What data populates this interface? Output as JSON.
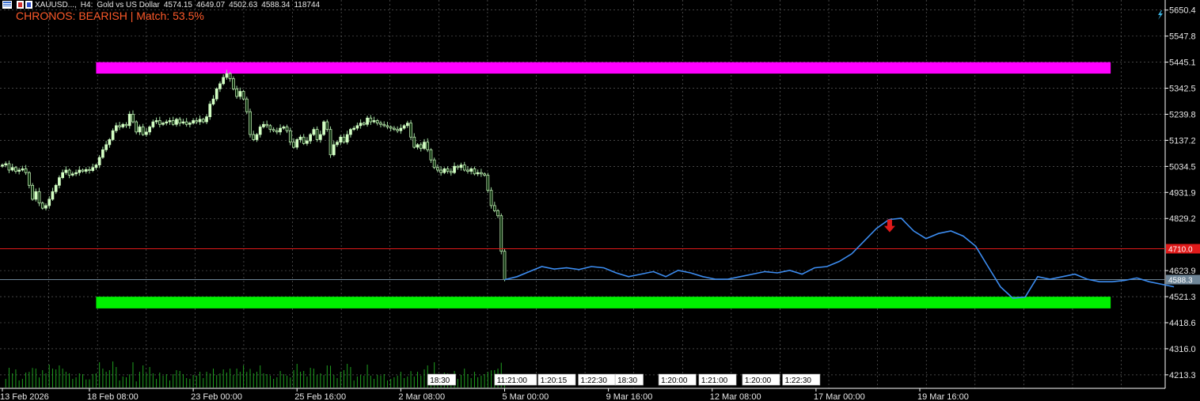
{
  "header": {
    "symbol": "XAUUSD...,",
    "timeframe": "H4:",
    "description": "Gold vs US Dollar",
    "open": "4574.15",
    "high": "4649.07",
    "low": "4502.63",
    "close": "4588.34",
    "volume": "118744"
  },
  "indicator": {
    "text": "CHRONOS: BEARISH | Match: 53.5%",
    "color": "#ff5a2a"
  },
  "colors": {
    "background": "#000000",
    "grid": "#c8c8c8",
    "bull_candle": "#d2ffc3",
    "bear_candle": "#c8ffd2",
    "wick": "#a0dca0",
    "volume": "#1f9f1f",
    "forecast": "#3c8cf0",
    "resistance_zone": "#ff00ff",
    "support_zone": "#00f000",
    "red_line": "#e01a1a",
    "signal_arrow": "#e01a1a",
    "bid_line": "#7a8fa0"
  },
  "chart_data": {
    "type": "candlestick",
    "y_axis_ticks": [
      "5650.4",
      "5547.8",
      "5445.1",
      "5342.5",
      "5239.8",
      "5137.2",
      "5034.5",
      "4931.9",
      "4829.2",
      "4623.9",
      "4521.3",
      "4418.6",
      "4316.0",
      "4213.3"
    ],
    "ylim": [
      4160,
      5690
    ],
    "x_axis_ticks": [
      "13 Feb 2026",
      "18 Feb 08:00",
      "23 Feb 00:00",
      "25 Feb 16:00",
      "2 Mar 08:00",
      "5 Mar 00:00",
      "9 Mar 16:00",
      "12 Mar 08:00",
      "17 Mar 00:00",
      "19 Mar 16:00"
    ],
    "x_axis_tick_bar_index": [
      0,
      26,
      57,
      88,
      119,
      150,
      181,
      212,
      243,
      274
    ],
    "price_tags": [
      {
        "label": "4710.0",
        "value": 4710.0,
        "bg": "#e01a1a",
        "fg": "#ffffff"
      },
      {
        "label": "4588.3",
        "value": 4588.3,
        "bg": "#6e8597",
        "fg": "#ffffff"
      }
    ],
    "zones": [
      {
        "name": "resistance",
        "from": 5400,
        "to": 5445,
        "start_bar": 28,
        "end_bar": 331
      },
      {
        "name": "support",
        "from": 4475,
        "to": 4521,
        "start_bar": 28,
        "end_bar": 331
      }
    ],
    "signal": {
      "type": "arrow-down",
      "bar": 265,
      "value": 4800
    },
    "time_tags": [
      "18:30",
      "11:21:00",
      "1:20:15",
      "1:22:30",
      "18:30",
      "1:20:00",
      "1:21:00",
      "1:20:00",
      "1:22:30"
    ],
    "time_tag_bar_index": [
      127,
      147,
      160,
      172,
      183,
      196,
      208,
      221,
      233
    ],
    "close_prices": [
      5040,
      5045,
      5020,
      5030,
      5015,
      5020,
      5025,
      5010,
      4960,
      4905,
      4935,
      4890,
      4870,
      4880,
      4905,
      4935,
      4960,
      4990,
      5010,
      5020,
      5000,
      5005,
      5010,
      5020,
      5015,
      5022,
      5018,
      5030,
      5040,
      5070,
      5100,
      5120,
      5140,
      5175,
      5195,
      5190,
      5200,
      5195,
      5240,
      5210,
      5170,
      5190,
      5160,
      5170,
      5190,
      5210,
      5215,
      5200,
      5205,
      5210,
      5215,
      5200,
      5220,
      5205,
      5210,
      5200,
      5205,
      5215,
      5210,
      5220,
      5210,
      5230,
      5280,
      5300,
      5340,
      5360,
      5385,
      5400,
      5380,
      5340,
      5310,
      5330,
      5300,
      5250,
      5160,
      5140,
      5160,
      5190,
      5200,
      5195,
      5180,
      5175,
      5170,
      5185,
      5190,
      5175,
      5130,
      5110,
      5140,
      5150,
      5125,
      5135,
      5160,
      5180,
      5140,
      5160,
      5210,
      5180,
      5080,
      5120,
      5130,
      5150,
      5130,
      5160,
      5180,
      5185,
      5195,
      5205,
      5200,
      5225,
      5210,
      5215,
      5205,
      5200,
      5195,
      5190,
      5185,
      5180,
      5175,
      5185,
      5195,
      5205,
      5150,
      5110,
      5120,
      5105,
      5130,
      5100,
      5060,
      5030,
      5020,
      5010,
      5025,
      5015,
      5010,
      5035,
      5030,
      5040,
      5020,
      5015,
      5025,
      5005,
      5010,
      5005,
      5000,
      4940,
      4880,
      4860,
      4840,
      4700,
      4588
    ],
    "forecast": [
      4588,
      4600,
      4620,
      4640,
      4630,
      4635,
      4628,
      4640,
      4635,
      4615,
      4600,
      4610,
      4620,
      4600,
      4625,
      4615,
      4600,
      4590,
      4590,
      4600,
      4610,
      4620,
      4615,
      4625,
      4610,
      4635,
      4640,
      4660,
      4690,
      4740,
      4790,
      4825,
      4830,
      4780,
      4750,
      4770,
      4780,
      4760,
      4720,
      4640,
      4560,
      4515,
      4520,
      4600,
      4590,
      4600,
      4610,
      4590,
      4580,
      4580,
      4585,
      4595,
      4580,
      4570,
      4560
    ]
  }
}
